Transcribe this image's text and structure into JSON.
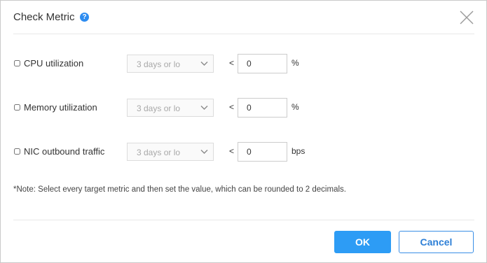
{
  "dialog": {
    "title": "Check Metric",
    "help_icon": "question-circle-icon",
    "help_glyph": "?",
    "close_icon": "close-icon"
  },
  "metrics": [
    {
      "label": "CPU utilization",
      "checked": false,
      "period": "3 days or lo",
      "comparator": "<",
      "value": "0",
      "unit": "%"
    },
    {
      "label": "Memory utilization",
      "checked": false,
      "period": "3 days or lo",
      "comparator": "<",
      "value": "0",
      "unit": "%"
    },
    {
      "label": "NIC outbound traffic",
      "checked": false,
      "period": "3 days or lo",
      "comparator": "<",
      "value": "0",
      "unit": "bps"
    }
  ],
  "note": "*Note: Select every target metric and then set the value, which can be rounded to 2 decimals.",
  "footer": {
    "ok_label": "OK",
    "cancel_label": "Cancel"
  },
  "colors": {
    "primary": "#2d9cf5",
    "help_icon": "#2d8cf0",
    "cancel_border": "#3a8ee6"
  }
}
